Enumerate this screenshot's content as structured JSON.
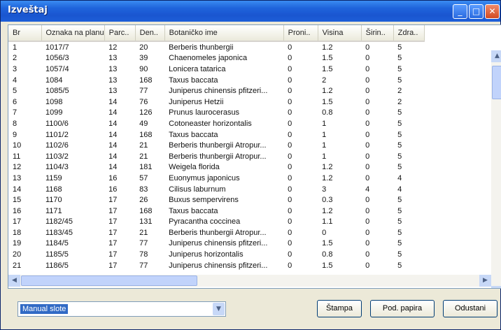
{
  "window": {
    "title": "Izveštaj"
  },
  "titlebar": {
    "min_glyph": "_",
    "max_glyph": "□",
    "close_glyph": "✕"
  },
  "columns": [
    "Br",
    "Oznaka na planu",
    "Parc..",
    "Den..",
    "Botaničko ime",
    "Proni..",
    "Visina",
    "Širin..",
    "Zdra.."
  ],
  "rows": [
    [
      "1",
      "1017/7",
      "12",
      "20",
      "Berberis thunbergii",
      "0",
      "1.2",
      "0",
      "5"
    ],
    [
      "2",
      "1056/3",
      "13",
      "39",
      "Chaenomeles japonica",
      "0",
      "1.5",
      "0",
      "5"
    ],
    [
      "3",
      "1057/4",
      "13",
      "90",
      "Lonicera tatarica",
      "0",
      "1.5",
      "0",
      "5"
    ],
    [
      "4",
      "1084",
      "13",
      "168",
      "Taxus baccata",
      "0",
      "2",
      "0",
      "5"
    ],
    [
      "5",
      "1085/5",
      "13",
      "77",
      "Juniperus chinensis pfitzeri...",
      "0",
      "1.2",
      "0",
      "2"
    ],
    [
      "6",
      "1098",
      "14",
      "76",
      "Juniperus Hetzii",
      "0",
      "1.5",
      "0",
      "2"
    ],
    [
      "7",
      "1099",
      "14",
      "126",
      "Prunus laurocerasus",
      "0",
      "0.8",
      "0",
      "5"
    ],
    [
      "8",
      "1100/6",
      "14",
      "49",
      "Cotoneaster horizontalis",
      "0",
      "1",
      "0",
      "5"
    ],
    [
      "9",
      "1101/2",
      "14",
      "168",
      "Taxus baccata",
      "0",
      "1",
      "0",
      "5"
    ],
    [
      "10",
      "1102/6",
      "14",
      "21",
      "Berberis thunbergii Atropur...",
      "0",
      "1",
      "0",
      "5"
    ],
    [
      "11",
      "1103/2",
      "14",
      "21",
      "Berberis thunbergii Atropur...",
      "0",
      "1",
      "0",
      "5"
    ],
    [
      "12",
      "1104/3",
      "14",
      "181",
      "Weigela florida",
      "0",
      "1.2",
      "0",
      "5"
    ],
    [
      "13",
      "1159",
      "16",
      "57",
      "Euonymus japonicus",
      "0",
      "1.2",
      "0",
      "4"
    ],
    [
      "14",
      "1168",
      "16",
      "83",
      "Cilisus laburnum",
      "0",
      "3",
      "4",
      "4"
    ],
    [
      "15",
      "1170",
      "17",
      "26",
      "Buxus sempervirens",
      "0",
      "0.3",
      "0",
      "5"
    ],
    [
      "16",
      "1171",
      "17",
      "168",
      "Taxus baccata",
      "0",
      "1.2",
      "0",
      "5"
    ],
    [
      "17",
      "1182/45",
      "17",
      "131",
      "Pyracantha coccinea",
      "0",
      "1.1",
      "0",
      "5"
    ],
    [
      "18",
      "1183/45",
      "17",
      "21",
      "Berberis thunbergii Atropur...",
      "0",
      "0",
      "0",
      "5"
    ],
    [
      "19",
      "1184/5",
      "17",
      "77",
      "Juniperus chinensis pfitzeri...",
      "0",
      "1.5",
      "0",
      "5"
    ],
    [
      "20",
      "1185/5",
      "17",
      "78",
      "Juniperus horizontalis",
      "0",
      "0.8",
      "0",
      "5"
    ],
    [
      "21",
      "1186/5",
      "17",
      "77",
      "Juniperus chinensis pfitzeri...",
      "0",
      "1.5",
      "0",
      "5"
    ]
  ],
  "footer": {
    "combo_value": "Manual slote",
    "print_label": "Štampa",
    "page_label": "Pod. papira",
    "cancel_label": "Odustani"
  }
}
